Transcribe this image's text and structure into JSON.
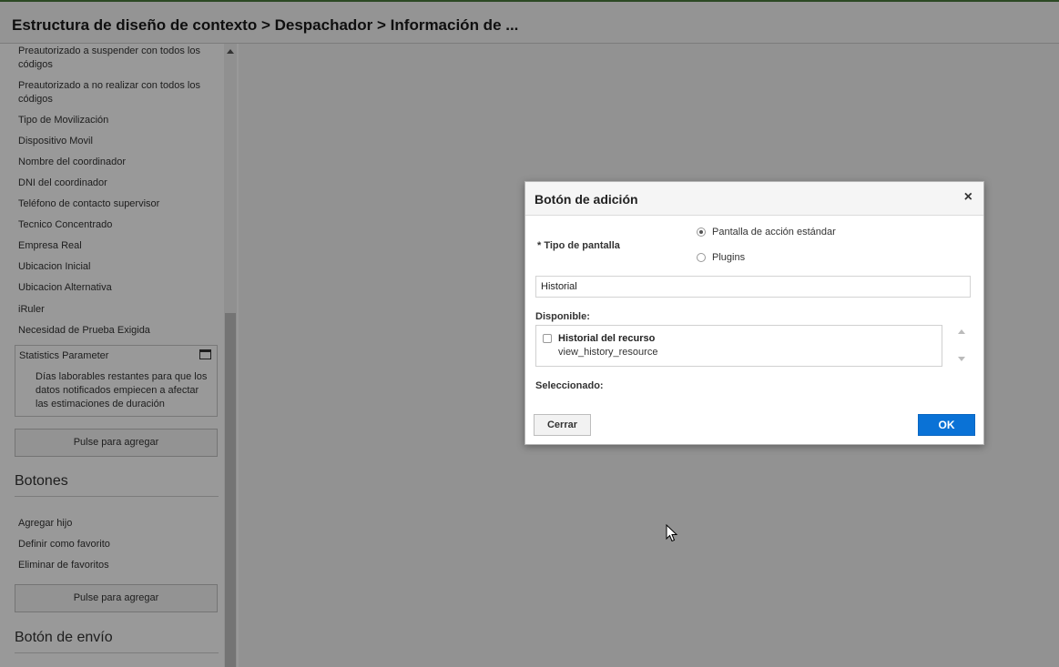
{
  "header": {
    "title": "Estructura de diseño de contexto > Despachador > Información de ..."
  },
  "sidebar": {
    "items": [
      "Preautorizado a suspender con todos los códigos",
      "Preautorizado a no realizar con todos los códigos",
      "Tipo de Movilización",
      "Dispositivo Movil",
      "Nombre del coordinador",
      "DNI del coordinador",
      "Teléfono de contacto supervisor",
      "Tecnico Concentrado",
      "Empresa Real",
      "Ubicacion Inicial",
      "Ubicacion Alternativa",
      "iRuler",
      "Necesidad de Prueba Exigida"
    ],
    "statistics": {
      "title": "Statistics Parameter",
      "description": "Días laborables restantes para que los datos notificados empiecen a afectar las estimaciones de duración"
    },
    "add_label_1": "Pulse para agregar",
    "botones": {
      "title": "Botones",
      "items": [
        "Agregar hijo",
        "Definir como favorito",
        "Eliminar de favoritos"
      ]
    },
    "add_label_2": "Pulse para agregar",
    "envio_title": "Botón de envío"
  },
  "dialog": {
    "title": "Botón de adición",
    "close_icon": "×",
    "screen_type_label": "* Tipo de pantalla",
    "radio_options": [
      {
        "label": "Pantalla de acción estándar",
        "selected": true
      },
      {
        "label": "Plugins",
        "selected": false
      }
    ],
    "search_value": "Historial",
    "available_label": "Disponible:",
    "available_items": [
      {
        "name": "Historial del recurso",
        "key": "view_history_resource",
        "checked": false
      }
    ],
    "selected_label": "Seleccionado:",
    "cancel_label": "Cerrar",
    "ok_label": "OK",
    "accent_color": "#0a72d6"
  }
}
